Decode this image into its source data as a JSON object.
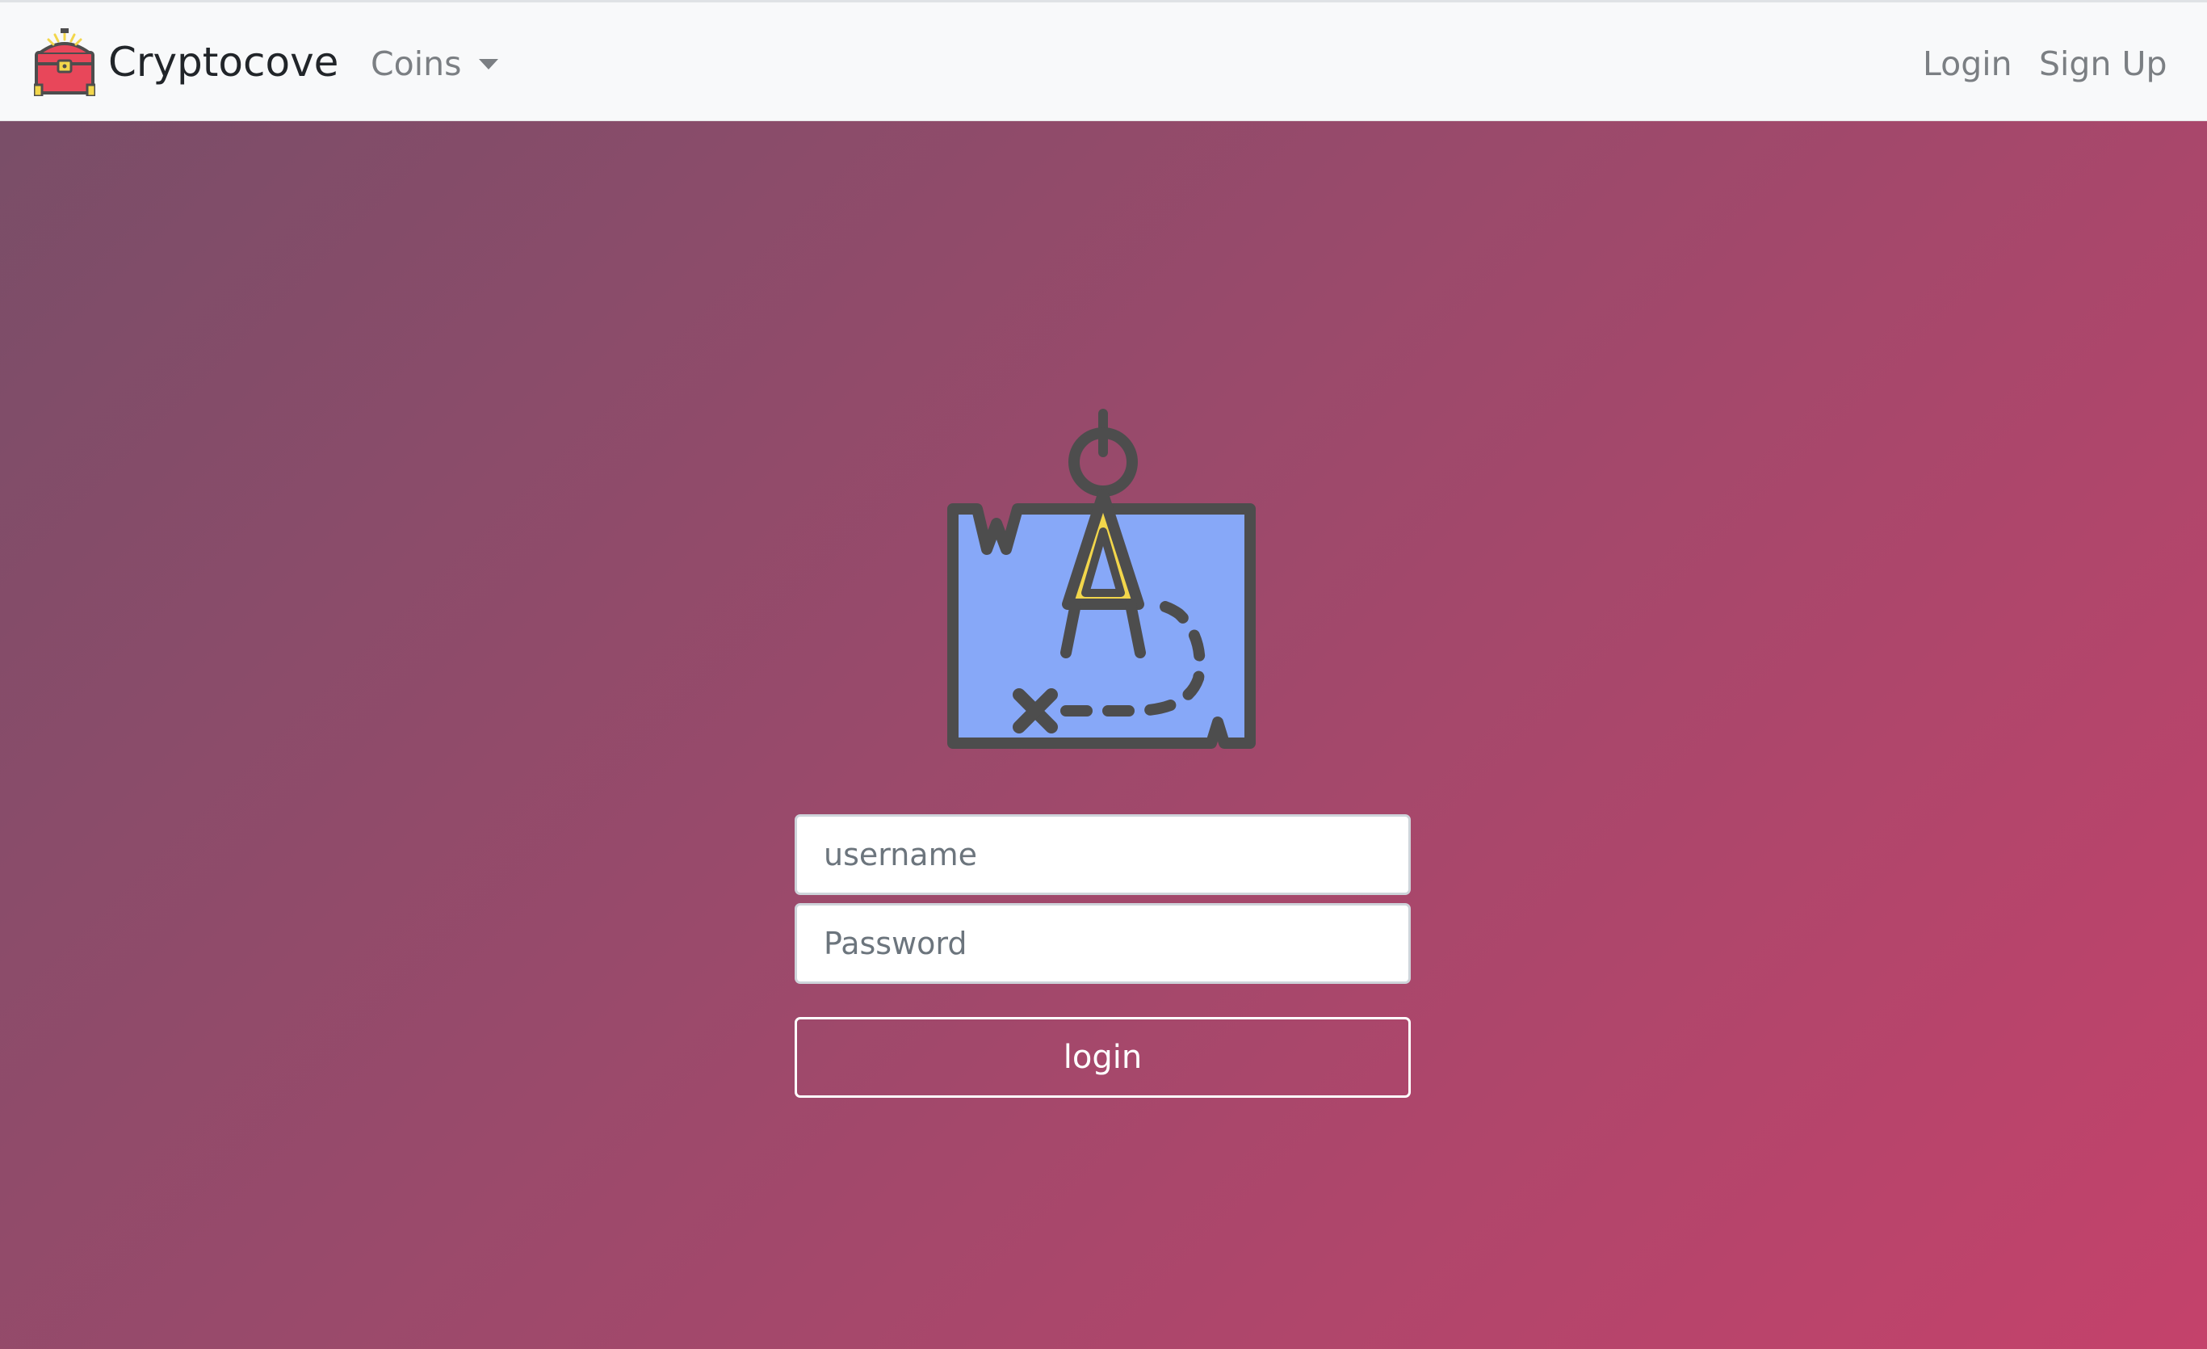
{
  "navbar": {
    "brand": {
      "logo_icon": "treasure-chest-icon",
      "name": "Cryptocove"
    },
    "coins_dropdown": {
      "label": "Coins",
      "icon": "caret-down-icon"
    },
    "login_link": "Login",
    "signup_link": "Sign Up"
  },
  "hero": {
    "illustration_icon": "treasure-map-compass-icon"
  },
  "login_form": {
    "username_placeholder": "username",
    "username_value": "",
    "password_placeholder": "Password",
    "password_value": "",
    "submit_label": "login"
  },
  "colors": {
    "navbar_bg": "#f8f9fa",
    "gradient_start": "#774e68",
    "gradient_end": "#c4426b",
    "map_blue": "#87a8f8",
    "compass_yellow": "#f2d64b",
    "chest_red": "#e8475a",
    "outline_gray": "#4d4d4d"
  }
}
